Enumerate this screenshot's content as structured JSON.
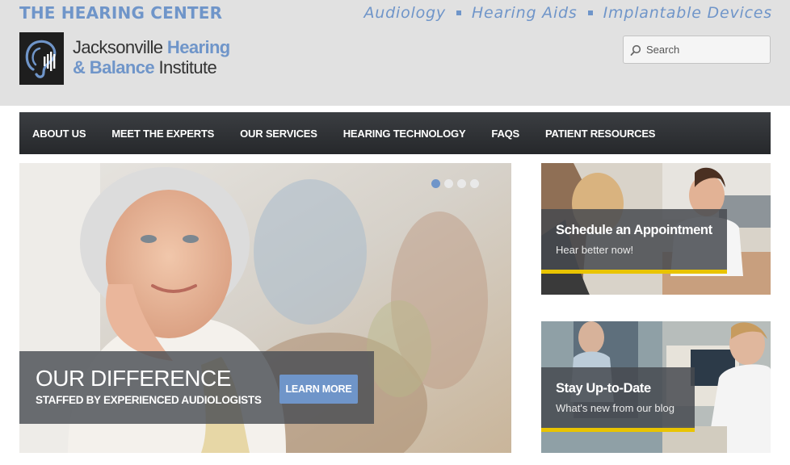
{
  "header": {
    "brand_title": "THE HEARING CENTER",
    "top_links": [
      "Audiology",
      "Hearing Aids",
      "Implantable Devices"
    ],
    "logo": {
      "line1_a": "Jacksonville ",
      "line1_b": "Hearing",
      "line2_a": "& Balance",
      "line2_b": " Institute"
    },
    "search": {
      "placeholder": "Search"
    }
  },
  "nav": {
    "items": [
      "ABOUT US",
      "MEET THE EXPERTS",
      "OUR SERVICES",
      "HEARING TECHNOLOGY",
      "FAQS",
      "PATIENT RESOURCES"
    ]
  },
  "hero": {
    "title": "OUR DIFFERENCE",
    "subtitle": "STAFFED BY EXPERIENCED AUDIOLOGISTS",
    "button": "LEARN MORE",
    "slide_count": 4,
    "active_slide": 1
  },
  "cards": [
    {
      "title": "Schedule an Appointment",
      "subtitle": "Hear better now!"
    },
    {
      "title": "Stay Up-to-Date",
      "subtitle": "What's new from our blog"
    }
  ],
  "colors": {
    "accent_blue": "#6f95c9",
    "nav_dark": "#2f3235",
    "header_gray": "#e1e1e1",
    "card_stripe": "#e9c400"
  }
}
